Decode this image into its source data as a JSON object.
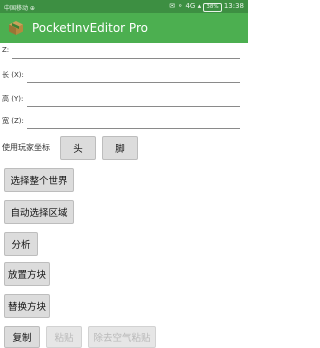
{
  "status_bar": {
    "carrier": "中国移动 ⊕",
    "signal_glyphs": "✉ ⚬ 4G ▴",
    "battery": "38%",
    "time": "13:38"
  },
  "app_bar": {
    "title": "PocketInvEditor Pro",
    "icon": "green-box-icon"
  },
  "fields": {
    "z_label": "Z:",
    "length_label": "长 (X):",
    "height_label": "高 (Y):",
    "width_label": "宽 (Z):"
  },
  "player_coords": {
    "label": "使用玩家坐标",
    "head_button": "头",
    "feet_button": "脚"
  },
  "actions": {
    "select_world": "选择整个世界",
    "auto_select": "自动选择区域",
    "analyze": "分析",
    "place_block": "放置方块",
    "replace_block": "替换方块",
    "copy": "复制",
    "paste": "粘贴",
    "paste_no_air": "除去空气粘贴"
  },
  "colors": {
    "status_bar": "#3d8f42",
    "app_bar": "#4caf50",
    "button": "#dcdcdc"
  }
}
